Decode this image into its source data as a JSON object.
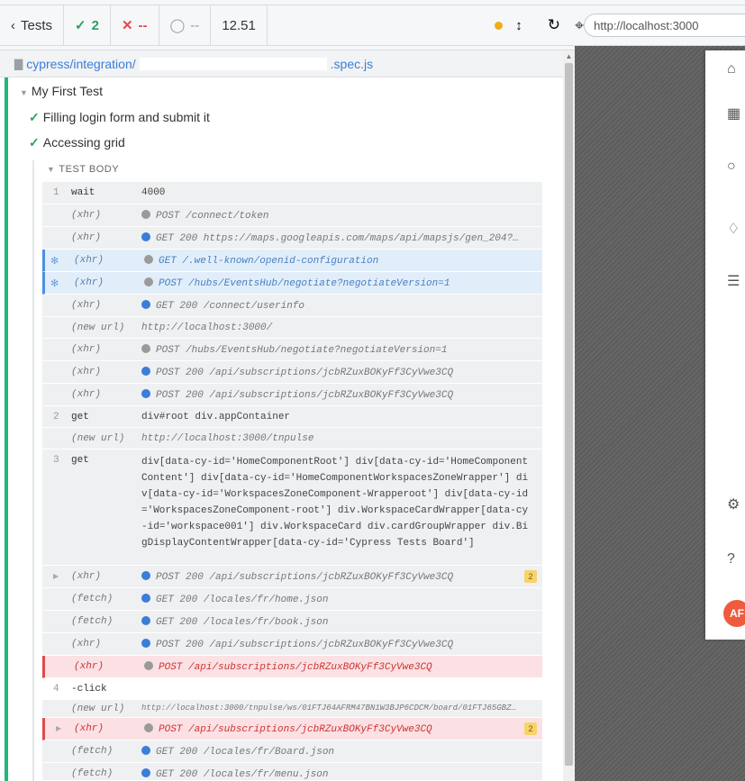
{
  "header": {
    "tests_label": "Tests",
    "passed": "2",
    "failed": "--",
    "pending": "--",
    "duration": "12.51"
  },
  "browser": {
    "url": "http://localhost:3000"
  },
  "spec": {
    "path_prefix": "cypress/integration/",
    "path_suffix": ".spec.js"
  },
  "suite": {
    "title": "My First Test",
    "tests": [
      {
        "title": "Filling login form and submit it"
      },
      {
        "title": "Accessing grid"
      }
    ],
    "test_body_label": "TEST BODY"
  },
  "commands": [
    {
      "num": "1",
      "name": "wait",
      "msg": "4000"
    },
    {
      "name": "(xhr)",
      "dot": "gray",
      "msg": "POST /connect/token"
    },
    {
      "name": "(xhr)",
      "dot": "blue",
      "msg": "GET 200 https://maps.googleapis.com/maps/api/mapsjs/gen_204?cs…"
    },
    {
      "name": "(xhr)",
      "dot": "gray",
      "msg": "GET /.well-known/openid-configuration"
    },
    {
      "name": "(xhr)",
      "dot": "gray",
      "msg": "POST /hubs/EventsHub/negotiate?negotiateVersion=1"
    },
    {
      "name": "(xhr)",
      "dot": "blue",
      "msg": "GET 200 /connect/userinfo"
    },
    {
      "name": "(new url)",
      "msg": "http://localhost:3000/"
    },
    {
      "name": "(xhr)",
      "dot": "gray",
      "msg": "POST /hubs/EventsHub/negotiate?negotiateVersion=1"
    },
    {
      "name": "(xhr)",
      "dot": "blue",
      "msg": "POST 200 /api/subscriptions/jcbRZuxBOKyFf3CyVwe3CQ"
    },
    {
      "name": "(xhr)",
      "dot": "blue",
      "msg": "POST 200 /api/subscriptions/jcbRZuxBOKyFf3CyVwe3CQ"
    },
    {
      "num": "2",
      "name": "get",
      "msg": "div#root div.appContainer"
    },
    {
      "name": "(new url)",
      "msg": "http://localhost:3000/tnpulse"
    },
    {
      "num": "3",
      "name": "get",
      "msg": "div[data-cy-id='HomeComponentRoot'] div[data-cy-id='HomeComponentContent'] div[data-cy-id='HomeComponentWorkspacesZoneWrapper'] div[data-cy-id='WorkspacesZoneComponent-Wrapperoot'] div[data-cy-id='WorkspacesZoneComponent-root'] div.WorkspaceCardWrapper[data-cy-id='workspace001'] div.WorkspaceCard div.cardGroupWrapper div.BigDisplayContentWrapper[data-cy-id='Cypress Tests Board']"
    },
    {
      "name": "(xhr)",
      "dot": "blue",
      "msg": "POST 200 /api/subscriptions/jcbRZuxBOKyFf3CyVwe3CQ",
      "badge": "2"
    },
    {
      "name": "(fetch)",
      "dot": "blue",
      "msg": "GET 200 /locales/fr/home.json"
    },
    {
      "name": "(fetch)",
      "dot": "blue",
      "msg": "GET 200 /locales/fr/book.json"
    },
    {
      "name": "(xhr)",
      "dot": "blue",
      "msg": "POST 200 /api/subscriptions/jcbRZuxBOKyFf3CyVwe3CQ"
    },
    {
      "name": "(xhr)",
      "dot": "gray",
      "msg": "POST /api/subscriptions/jcbRZuxBOKyFf3CyVwe3CQ"
    },
    {
      "num": "4",
      "name": "-click",
      "msg": ""
    },
    {
      "name": "(new url)",
      "msg": "http://localhost:3000/tnpulse/ws/01FTJ64AFRM47BN1W3BJP6CDCM/board/01FTJ65GBZQ…"
    },
    {
      "name": "(xhr)",
      "dot": "gray",
      "msg": "POST /api/subscriptions/jcbRZuxBOKyFf3CyVwe3CQ",
      "badge": "2"
    },
    {
      "name": "(fetch)",
      "dot": "blue",
      "msg": "GET 200 /locales/fr/Board.json"
    },
    {
      "name": "(fetch)",
      "dot": "blue",
      "msg": "GET 200 /locales/fr/menu.json"
    }
  ],
  "app_sidebar": {
    "avatar_initials": "AF"
  }
}
